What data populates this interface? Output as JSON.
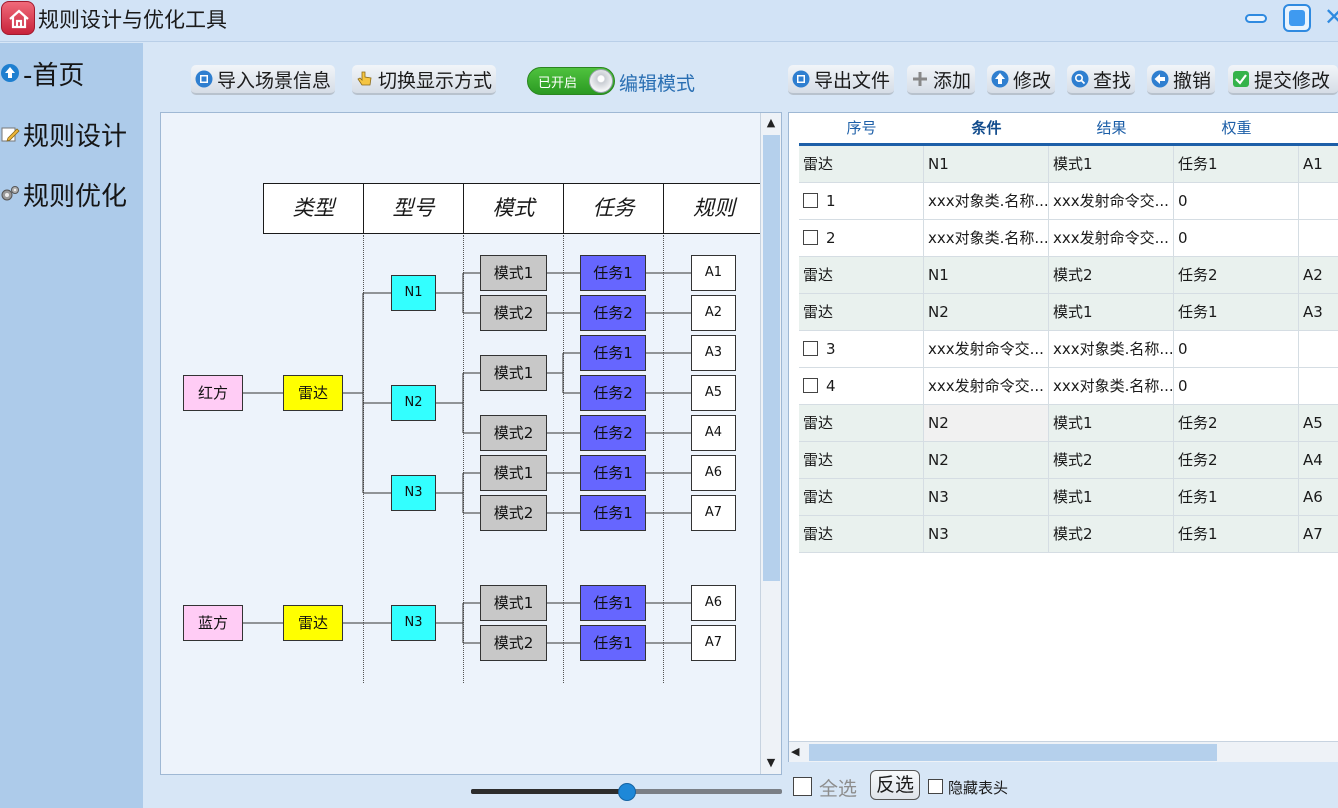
{
  "app": {
    "title": "规则设计与优化工具"
  },
  "sidebar": {
    "items": [
      {
        "label": "-首页",
        "icon": "up-arrow-icon"
      },
      {
        "label": "规则设计",
        "icon": "pencil-icon"
      },
      {
        "label": "规则优化",
        "icon": "gear-icon"
      }
    ]
  },
  "toolbar": {
    "import_label": "导入场景信息",
    "switch_label": "切换显示方式",
    "toggle_label": "已开启",
    "edit_mode_label": "编辑模式",
    "export_label": "导出文件",
    "add_label": "添加",
    "modify_label": "修改",
    "find_label": "查找",
    "undo_label": "撤销",
    "submit_label": "提交修改"
  },
  "diagram": {
    "headers": [
      "类型",
      "型号",
      "模式",
      "任务",
      "规则"
    ],
    "sides": [
      {
        "name": "红方",
        "type": "雷达"
      },
      {
        "name": "蓝方",
        "type": "雷达"
      }
    ],
    "models": [
      "N1",
      "N2",
      "N3",
      "N3"
    ],
    "modes": [
      "模式1",
      "模式2",
      "模式1",
      "模式2",
      "模式1",
      "模式2",
      "模式1",
      "模式2"
    ],
    "tasks": [
      "任务1",
      "任务2",
      "任务1",
      "任务2",
      "任务2",
      "任务1",
      "任务1",
      "任务1",
      "任务1"
    ],
    "rules": [
      "A1",
      "A2",
      "A3",
      "A5",
      "A4",
      "A6",
      "A7",
      "A6",
      "A7"
    ],
    "colors": {
      "side": "#ffccf5",
      "type": "#ffff00",
      "model": "#33ffff",
      "mode": "#c8c8c8",
      "task": "#6666ff",
      "rule": "#ffffff"
    }
  },
  "slider": {
    "value_percent": 50
  },
  "table": {
    "headers": [
      "序号",
      "条件",
      "结果",
      "权重"
    ],
    "rows": [
      {
        "kind": "group",
        "cells": [
          "雷达",
          "N1",
          "模式1",
          "任务1",
          "A1"
        ]
      },
      {
        "kind": "item",
        "cells": [
          "1",
          "xxx对象类.名称...",
          "xxx发射命令交...",
          "0",
          ""
        ]
      },
      {
        "kind": "item",
        "cells": [
          "2",
          "xxx对象类.名称...",
          "xxx发射命令交...",
          "0",
          ""
        ]
      },
      {
        "kind": "group",
        "cells": [
          "雷达",
          "N1",
          "模式2",
          "任务2",
          "A2"
        ]
      },
      {
        "kind": "group",
        "cells": [
          "雷达",
          "N2",
          "模式1",
          "任务1",
          "A3"
        ]
      },
      {
        "kind": "item",
        "cells": [
          "3",
          "xxx发射命令交...",
          "xxx对象类.名称...",
          "0",
          ""
        ]
      },
      {
        "kind": "item",
        "cells": [
          "4",
          "xxx发射命令交...",
          "xxx对象类.名称...",
          "0",
          ""
        ]
      },
      {
        "kind": "group",
        "cells": [
          "雷达",
          "N2",
          "模式1",
          "任务2",
          "A5"
        ]
      },
      {
        "kind": "group",
        "cells": [
          "雷达",
          "N2",
          "模式2",
          "任务2",
          "A4"
        ]
      },
      {
        "kind": "group",
        "cells": [
          "雷达",
          "N3",
          "模式1",
          "任务1",
          "A6"
        ]
      },
      {
        "kind": "group",
        "cells": [
          "雷达",
          "N3",
          "模式2",
          "任务1",
          "A7"
        ]
      }
    ]
  },
  "footer": {
    "select_all_label": "全选",
    "invert_label": "反选",
    "hide_header_label": "隐藏表头"
  }
}
